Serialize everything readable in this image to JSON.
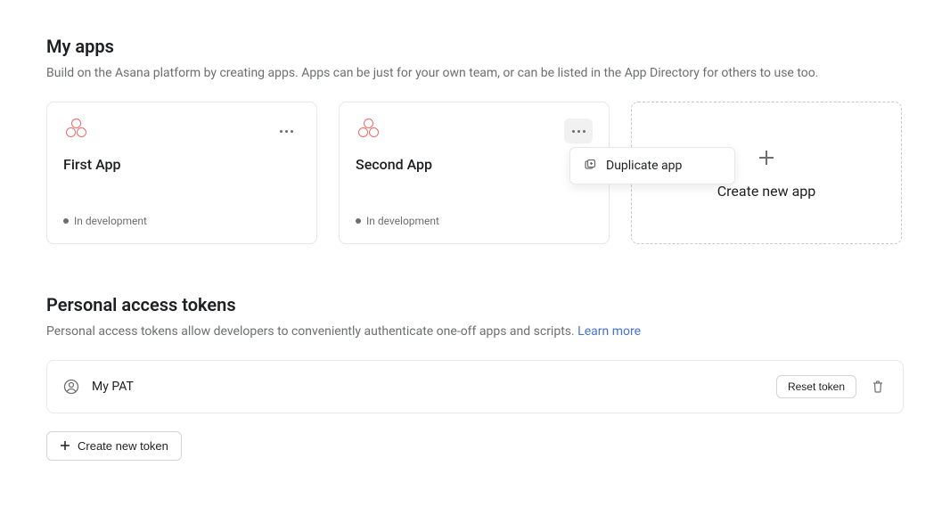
{
  "apps_section": {
    "title": "My apps",
    "subtitle": "Build on the Asana platform by creating apps. Apps can be just for your own team, or can be listed in the App Directory for others to use too.",
    "cards": [
      {
        "name": "First App",
        "status": "In development"
      },
      {
        "name": "Second App",
        "status": "In development"
      }
    ],
    "create_label": "Create new app",
    "dropdown": {
      "duplicate_label": "Duplicate app"
    }
  },
  "pat_section": {
    "title": "Personal access tokens",
    "subtitle_text": "Personal access tokens allow developers to conveniently authenticate one-off apps and scripts. ",
    "learn_more": "Learn more",
    "tokens": [
      {
        "name": "My PAT"
      }
    ],
    "reset_label": "Reset token",
    "create_label": "Create new token"
  }
}
